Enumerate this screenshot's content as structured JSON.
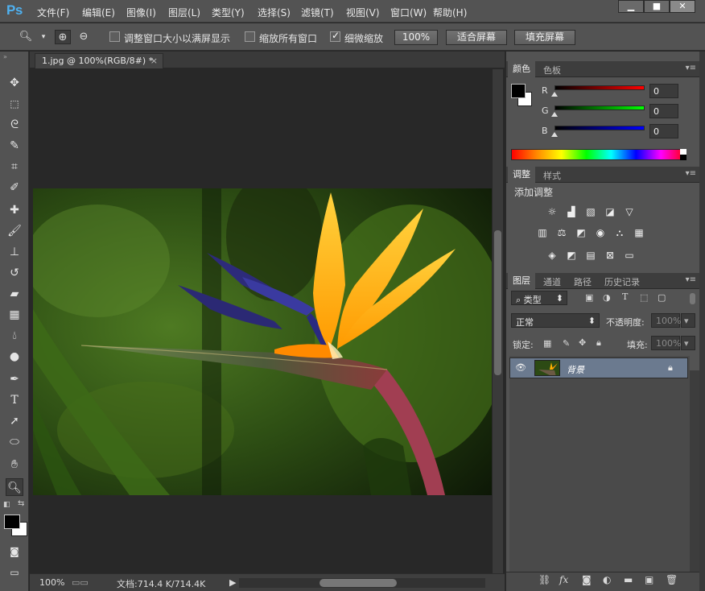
{
  "app": {
    "logo": "Ps",
    "menu": [
      "文件(F)",
      "编辑(E)",
      "图像(I)",
      "图层(L)",
      "类型(Y)",
      "选择(S)",
      "滤镜(T)",
      "视图(V)",
      "窗口(W)",
      "帮助(H)"
    ],
    "window_buttons": [
      "▁",
      "■",
      "✕"
    ]
  },
  "options": {
    "resize_windows_label": "调整窗口大小以满屏显示",
    "resize_windows_checked": false,
    "zoom_all_label": "缩放所有窗口",
    "zoom_all_checked": false,
    "scrubby_zoom_label": "细微缩放",
    "scrubby_zoom_checked": true,
    "btn_100": "100%",
    "btn_fit": "适合屏幕",
    "btn_fill": "填充屏幕"
  },
  "document": {
    "tab_title": "1.jpg @ 100%(RGB/8#) *",
    "tab_close": "×",
    "zoom_status": "100%",
    "doc_size": "文档:714.4 K/714.4K"
  },
  "color_panel": {
    "tabs": [
      "颜色",
      "色板"
    ],
    "active_tab": "颜色",
    "r_label": "R",
    "g_label": "G",
    "b_label": "B",
    "r_value": "0",
    "g_value": "0",
    "b_value": "0",
    "foreground": "#000000",
    "background": "#ffffff"
  },
  "adjust_panel": {
    "tabs": [
      "调整",
      "样式"
    ],
    "active_tab": "调整",
    "title": "添加调整"
  },
  "layers_panel": {
    "tabs": [
      "图层",
      "通道",
      "路径",
      "历史记录"
    ],
    "active_tab": "图层",
    "filter_kind": "类型",
    "blend_mode": "正常",
    "opacity_label": "不透明度:",
    "opacity_value": "100%",
    "lock_label": "锁定:",
    "fill_label": "填充:",
    "fill_value": "100%",
    "layers": [
      {
        "name": "背景",
        "visible": true,
        "locked": true
      }
    ]
  },
  "tools": [
    "move-tool",
    "marquee-tool",
    "lasso-tool",
    "quick-select-tool",
    "crop-tool",
    "eyedropper-tool",
    "healing-brush-tool",
    "brush-tool",
    "clone-stamp-tool",
    "history-brush-tool",
    "eraser-tool",
    "gradient-tool",
    "blur-tool",
    "dodge-tool",
    "pen-tool",
    "type-tool",
    "path-select-tool",
    "ellipse-tool",
    "hand-tool",
    "zoom-tool"
  ],
  "active_tool": "zoom-tool"
}
